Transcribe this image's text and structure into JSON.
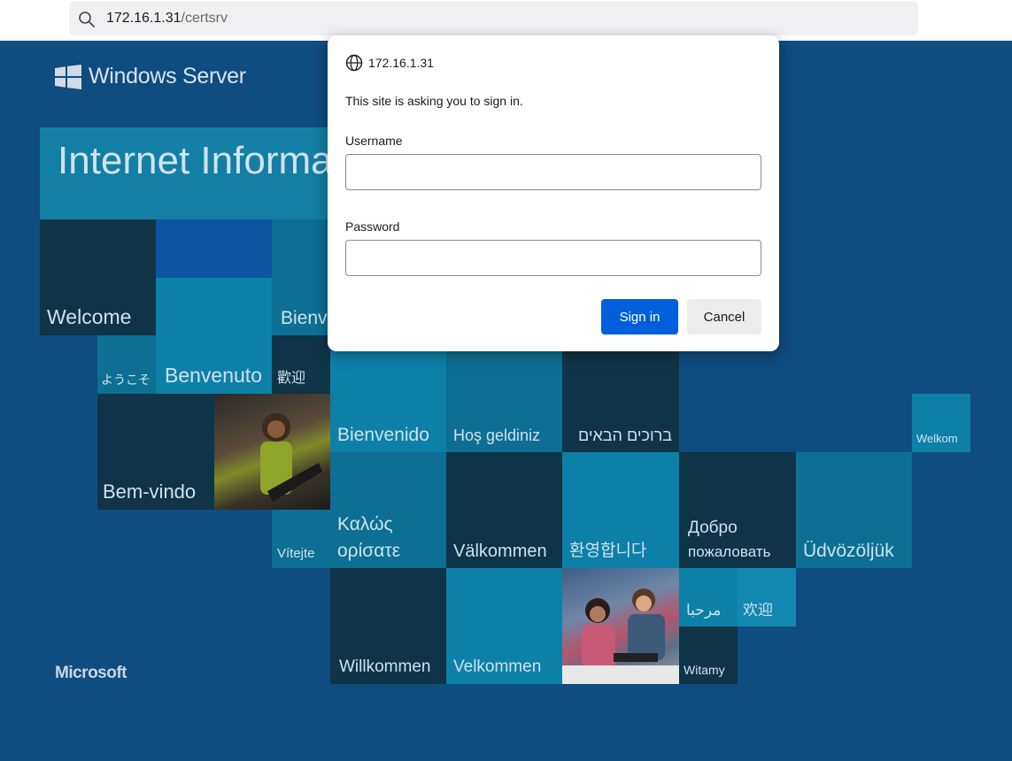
{
  "browser": {
    "url_host": "172.16.1.31",
    "url_path": "/certsrv"
  },
  "iis": {
    "logo_text": "Windows Server",
    "title": "Internet Informa",
    "footer": "Microsoft",
    "tiles": {
      "welcome": "Welcome",
      "bienv": "Bienv",
      "youkoso": "ようこそ",
      "benvenuto": "Benvenuto",
      "huanying_trad": "歡迎",
      "bienvenido": "Bienvenido",
      "hos_geldiniz": "Hoş geldiniz",
      "hebrew": "ברוכים הבאים",
      "welkom": "Welkom",
      "bem_vindo": "Bem-vindo",
      "kalos_1": "Καλώς",
      "kalos_2": "ορίσατε",
      "vitejte": "Vítejte",
      "valkommen": "Välkommen",
      "korean": "환영합니다",
      "dobro_1": "Добро",
      "dobro_2": "пожаловать",
      "udvozoljuk": "Üdvözöljük",
      "arabic": "مرحبا",
      "huanying_simpl": "欢迎",
      "willkommen": "Willkommen",
      "velkommen": "Velkommen",
      "witamy": "Witamy"
    }
  },
  "dialog": {
    "site": "172.16.1.31",
    "message": "This site is asking you to sign in.",
    "username_label": "Username",
    "username_value": "",
    "password_label": "Password",
    "password_value": "",
    "signin_label": "Sign in",
    "cancel_label": "Cancel"
  },
  "colors": {
    "page_bg": "#0f4c7f",
    "signin_button": "#005fdb"
  }
}
